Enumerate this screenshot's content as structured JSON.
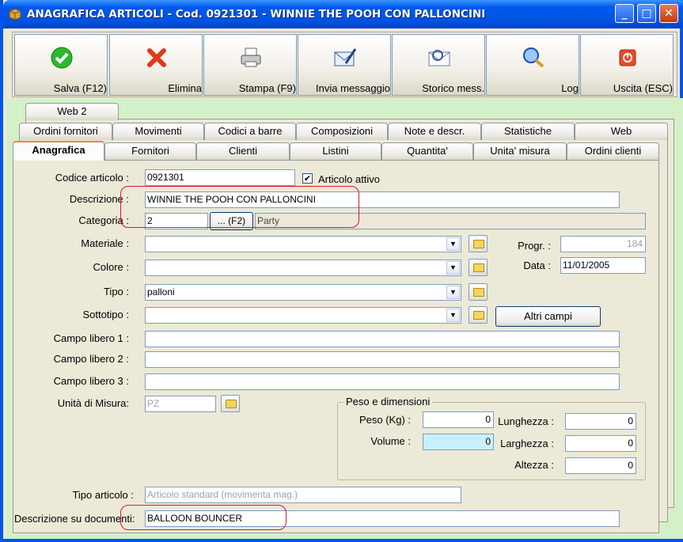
{
  "window": {
    "title": "ANAGRAFICA ARTICOLI - Cod. 0921301 - WINNIE THE POOH CON PALLONCINI"
  },
  "toolbar": [
    {
      "label": "Salva (F12)",
      "icon": "check-icon"
    },
    {
      "label": "Elimina",
      "icon": "delete-x-icon"
    },
    {
      "label": "Stampa (F9)",
      "icon": "printer-icon"
    },
    {
      "label": "Invia messaggio",
      "icon": "envelope-pen-icon"
    },
    {
      "label": "Storico mess.",
      "icon": "envelope-search-icon"
    },
    {
      "label": "Log",
      "icon": "log-search-icon"
    },
    {
      "label": "Uscita (ESC)",
      "icon": "power-icon"
    }
  ],
  "tabs": {
    "row3": [
      "Web 2"
    ],
    "row2": [
      "Ordini fornitori",
      "Movimenti",
      "Codici a barre",
      "Composizioni",
      "Note e descr.",
      "Statistiche",
      "Web"
    ],
    "row1": [
      "Anagrafica",
      "Fornitori",
      "Clienti",
      "Listini",
      "Quantita'",
      "Unita' misura",
      "Ordini clienti"
    ]
  },
  "form": {
    "codice_label": "Codice articolo :",
    "codice_value": "0921301",
    "attivo_label": "Articolo attivo",
    "attivo_check": "✔",
    "descrizione_label": "Descrizione :",
    "descrizione_value": "WINNIE THE POOH CON PALLONCINI",
    "categoria_label": "Categoria :",
    "categoria_value": "2",
    "categoria_button": "... (F2)",
    "categoria_desc": "Party",
    "materiale_label": "Materiale :",
    "materiale_value": "",
    "colore_label": "Colore :",
    "colore_value": "",
    "tipo_label": "Tipo :",
    "tipo_value": "palloni",
    "sottotipo_label": "Sottotipo :",
    "sottotipo_value": "",
    "altri_campi": "Altri campi",
    "progr_label": "Progr. :",
    "progr_value": "184",
    "data_label": "Data :",
    "data_value": "11/01/2005",
    "campo1_label": "Campo libero 1 :",
    "campo1_value": "",
    "campo2_label": "Campo libero 2 :",
    "campo2_value": "",
    "campo3_label": "Campo libero 3 :",
    "campo3_value": "",
    "um_label": "Unità di Misura:",
    "um_value": "PZ",
    "peso_group": "Peso e dimensioni",
    "peso_label": "Peso (Kg) :",
    "peso_value": "0",
    "volume_label": "Volume :",
    "volume_value": "0",
    "lunghezza_label": "Lunghezza :",
    "lunghezza_value": "0",
    "larghezza_label": "Larghezza :",
    "larghezza_value": "0",
    "altezza_label": "Altezza :",
    "altezza_value": "0",
    "tipo_articolo_label": "Tipo articolo :",
    "tipo_articolo_value": "Articolo standard (movimenta mag.)",
    "desc_doc_label": "Descrizione su documenti:",
    "desc_doc_value": "BALLOON BOUNCER"
  },
  "colors": {
    "title": "#0054e3",
    "highlight": "#e0142c",
    "bg": "#d4f0c8"
  }
}
